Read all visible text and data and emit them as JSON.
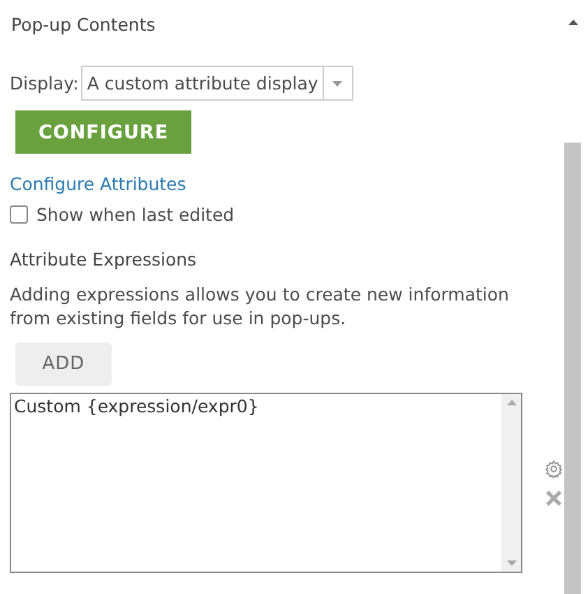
{
  "section_title": "Pop-up Contents",
  "display": {
    "label": "Display:",
    "value": "A custom attribute display"
  },
  "configure_button": "CONFIGURE",
  "configure_link": "Configure Attributes",
  "show_last_edited": {
    "label": "Show when last edited",
    "checked": false
  },
  "expressions_title": "Attribute Expressions",
  "expressions_description": "Adding expressions allows you to create new information from existing fields for use in pop-ups.",
  "add_button": "ADD",
  "expressions": [
    {
      "text": "Custom {expression/expr0}"
    }
  ]
}
